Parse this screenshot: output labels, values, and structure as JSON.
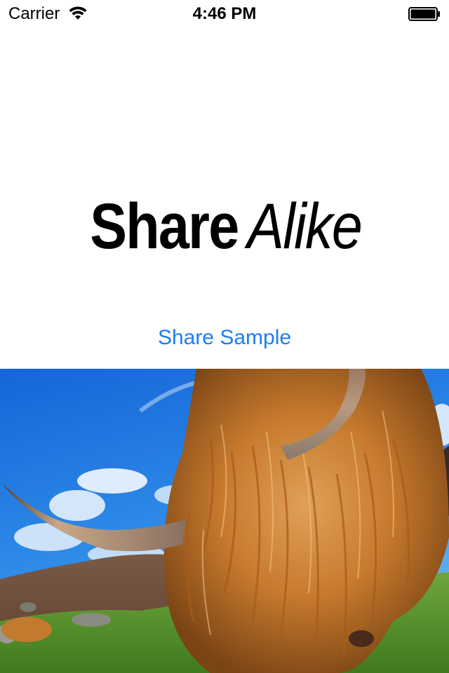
{
  "status_bar": {
    "carrier": "Carrier",
    "time": "4:46 PM",
    "wifi_icon": "wifi-icon",
    "battery_icon": "battery-icon"
  },
  "logo": {
    "bold_part": "Share",
    "italic_part": "Alike"
  },
  "share_button": {
    "label": "Share Sample",
    "color": "#1b7ef2"
  },
  "photo": {
    "subject": "highland-cow-photo"
  }
}
